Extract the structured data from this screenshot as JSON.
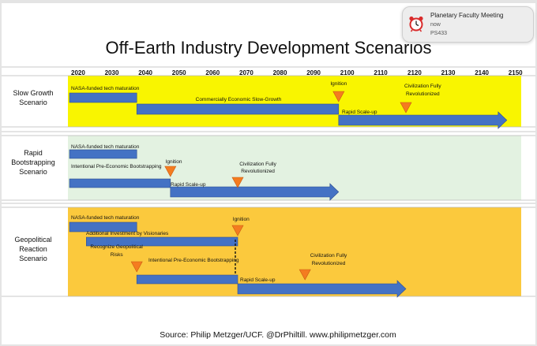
{
  "slide": {
    "title": "Off-Earth Industry Development Scenarios",
    "source": "Source: Philip Metzger/UCF. @DrPhiltill. www.philipmetzger.com"
  },
  "timeline": {
    "years": [
      "2020",
      "2030",
      "2040",
      "2050",
      "2060",
      "2070",
      "2080",
      "2090",
      "2100",
      "2110",
      "2120",
      "2130",
      "2140",
      "2150"
    ]
  },
  "scenarios": [
    {
      "name_lines": [
        "Slow Growth",
        "Scenario"
      ],
      "band_color": "#f9f500",
      "phases": [
        {
          "label": "NASA-funded tech maturation",
          "start": 2020,
          "end": 2040
        },
        {
          "label": "Commercially Economic Slow-Growth",
          "start": 2040,
          "end": 2100
        },
        {
          "label": "Rapid Scale-up",
          "start": 2100,
          "end": 2150
        }
      ],
      "milestones": [
        {
          "label": "Ignition",
          "year": 2100
        },
        {
          "label": "Civilization Fully Revolutionized",
          "year": 2120
        }
      ]
    },
    {
      "name_lines": [
        "Rapid",
        "Bootstrapping",
        "Scenario"
      ],
      "band_color": "#e3f2e1",
      "phases": [
        {
          "label": "NASA-funded tech maturation",
          "start": 2020,
          "end": 2040
        },
        {
          "label": "Intentional Pre-Economic Bootstrapping",
          "start": 2020,
          "end": 2050
        },
        {
          "label": "Rapid Scale-up",
          "start": 2050,
          "end": 2100
        }
      ],
      "milestones": [
        {
          "label": "Ignition",
          "year": 2050
        },
        {
          "label": "Civilization Fully Revolutionized",
          "year": 2070
        }
      ]
    },
    {
      "name_lines": [
        "Geopolitical",
        "Reaction",
        "Scenario"
      ],
      "band_color": "#fbc93d",
      "phases": [
        {
          "label": "NASA-funded tech maturation",
          "start": 2020,
          "end": 2040
        },
        {
          "label": "Additional Investment by Visionaries",
          "start": 2025,
          "end": 2070
        },
        {
          "label": "Intentional Pre-Economic Bootstrapping",
          "start": 2040,
          "end": 2070
        },
        {
          "label": "Rapid Scale-up",
          "start": 2070,
          "end": 2120
        }
      ],
      "milestones": [
        {
          "label": "Ignition",
          "year": 2070
        },
        {
          "label": "Recognize Geopolitical Risks",
          "year": 2040
        },
        {
          "label": "Civilization Fully Revolutionized",
          "year": 2090
        }
      ]
    }
  ],
  "notification": {
    "title": "Planetary Faculty Meeting",
    "time": "now",
    "subtitle": "PS433",
    "icon": "alarm-clock-icon"
  },
  "colors": {
    "arrow": "#4472c4",
    "milestone": "#f47c20"
  }
}
